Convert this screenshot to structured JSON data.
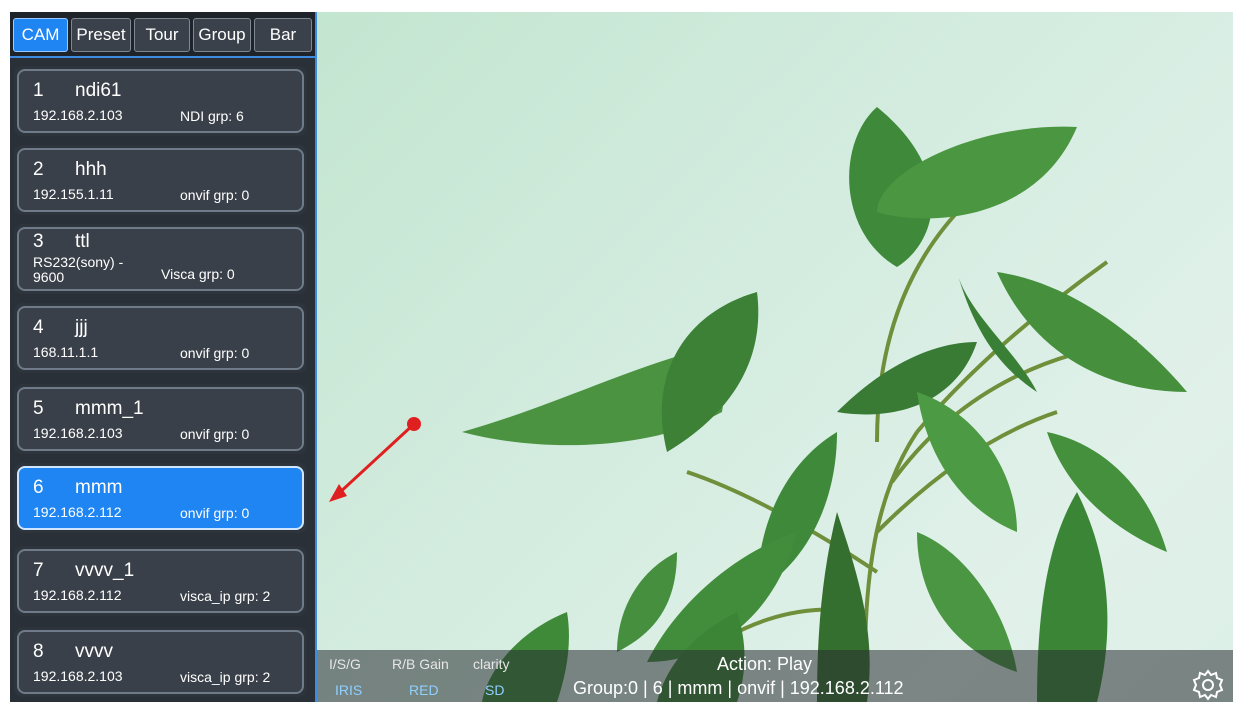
{
  "tabs": [
    {
      "label": "CAM"
    },
    {
      "label": "Preset"
    },
    {
      "label": "Tour"
    },
    {
      "label": "Group"
    },
    {
      "label": "Bar"
    }
  ],
  "cameras": [
    {
      "num": "1",
      "name": "ndi61",
      "ip": "192.168.2.103",
      "protocol": "NDI",
      "group": "grp: 6"
    },
    {
      "num": "2",
      "name": "hhh",
      "ip": "192.155.1.11",
      "protocol": "onvif",
      "group": "grp: 0"
    },
    {
      "num": "3",
      "name": "ttl",
      "ip": "RS232(sony) - 9600",
      "protocol": "Visca",
      "group": "grp: 0"
    },
    {
      "num": "4",
      "name": "jjj",
      "ip": "168.11.1.1",
      "protocol": "onvif",
      "group": "grp: 0"
    },
    {
      "num": "5",
      "name": "mmm_1",
      "ip": "192.168.2.103",
      "protocol": "onvif",
      "group": "grp: 0"
    },
    {
      "num": "6",
      "name": "mmm",
      "ip": "192.168.2.112",
      "protocol": "onvif",
      "group": "grp: 0"
    },
    {
      "num": "7",
      "name": "vvvv_1",
      "ip": "192.168.2.112",
      "protocol": "visca_ip",
      "group": "grp: 2"
    },
    {
      "num": "8",
      "name": "vvvv",
      "ip": "192.168.2.103",
      "protocol": "visca_ip",
      "group": "grp: 2"
    }
  ],
  "selected_camera_index": 5,
  "bottom_bar": {
    "labels": [
      "I/S/G",
      "R/B Gain",
      "clarity"
    ],
    "values": [
      "IRIS",
      "RED",
      "SD"
    ],
    "action": "Action: Play",
    "status": "Group:0 | 6 | mmm | onvif | 192.168.2.112"
  },
  "icons": {
    "settings": "gear-icon",
    "annotation": "red-arrow"
  },
  "colors": {
    "accent": "#1f85f3",
    "sidebar_bg": "#2a3038",
    "annotation_red": "#e02020"
  }
}
